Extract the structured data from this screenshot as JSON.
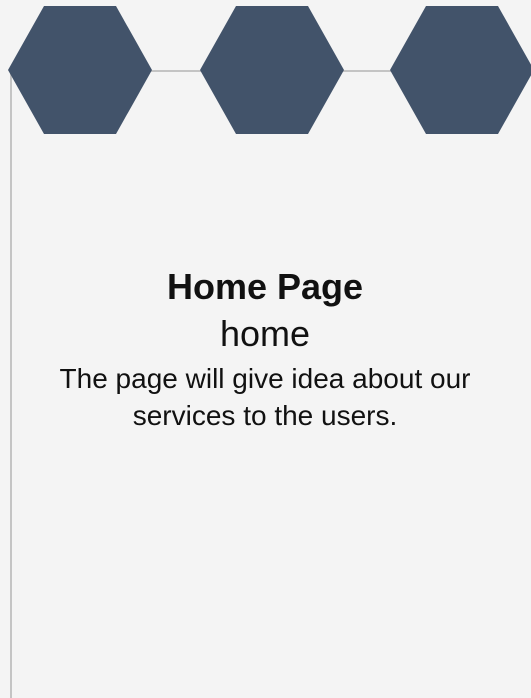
{
  "card": {
    "title": "Home Page",
    "subtitle": "home",
    "description": "The page will give idea about our services to the users."
  },
  "decoration": {
    "hexagon_color": "#42536a",
    "line_color": "#c4c4c4",
    "background": "#f4f4f4",
    "hexagon_count": 3
  }
}
